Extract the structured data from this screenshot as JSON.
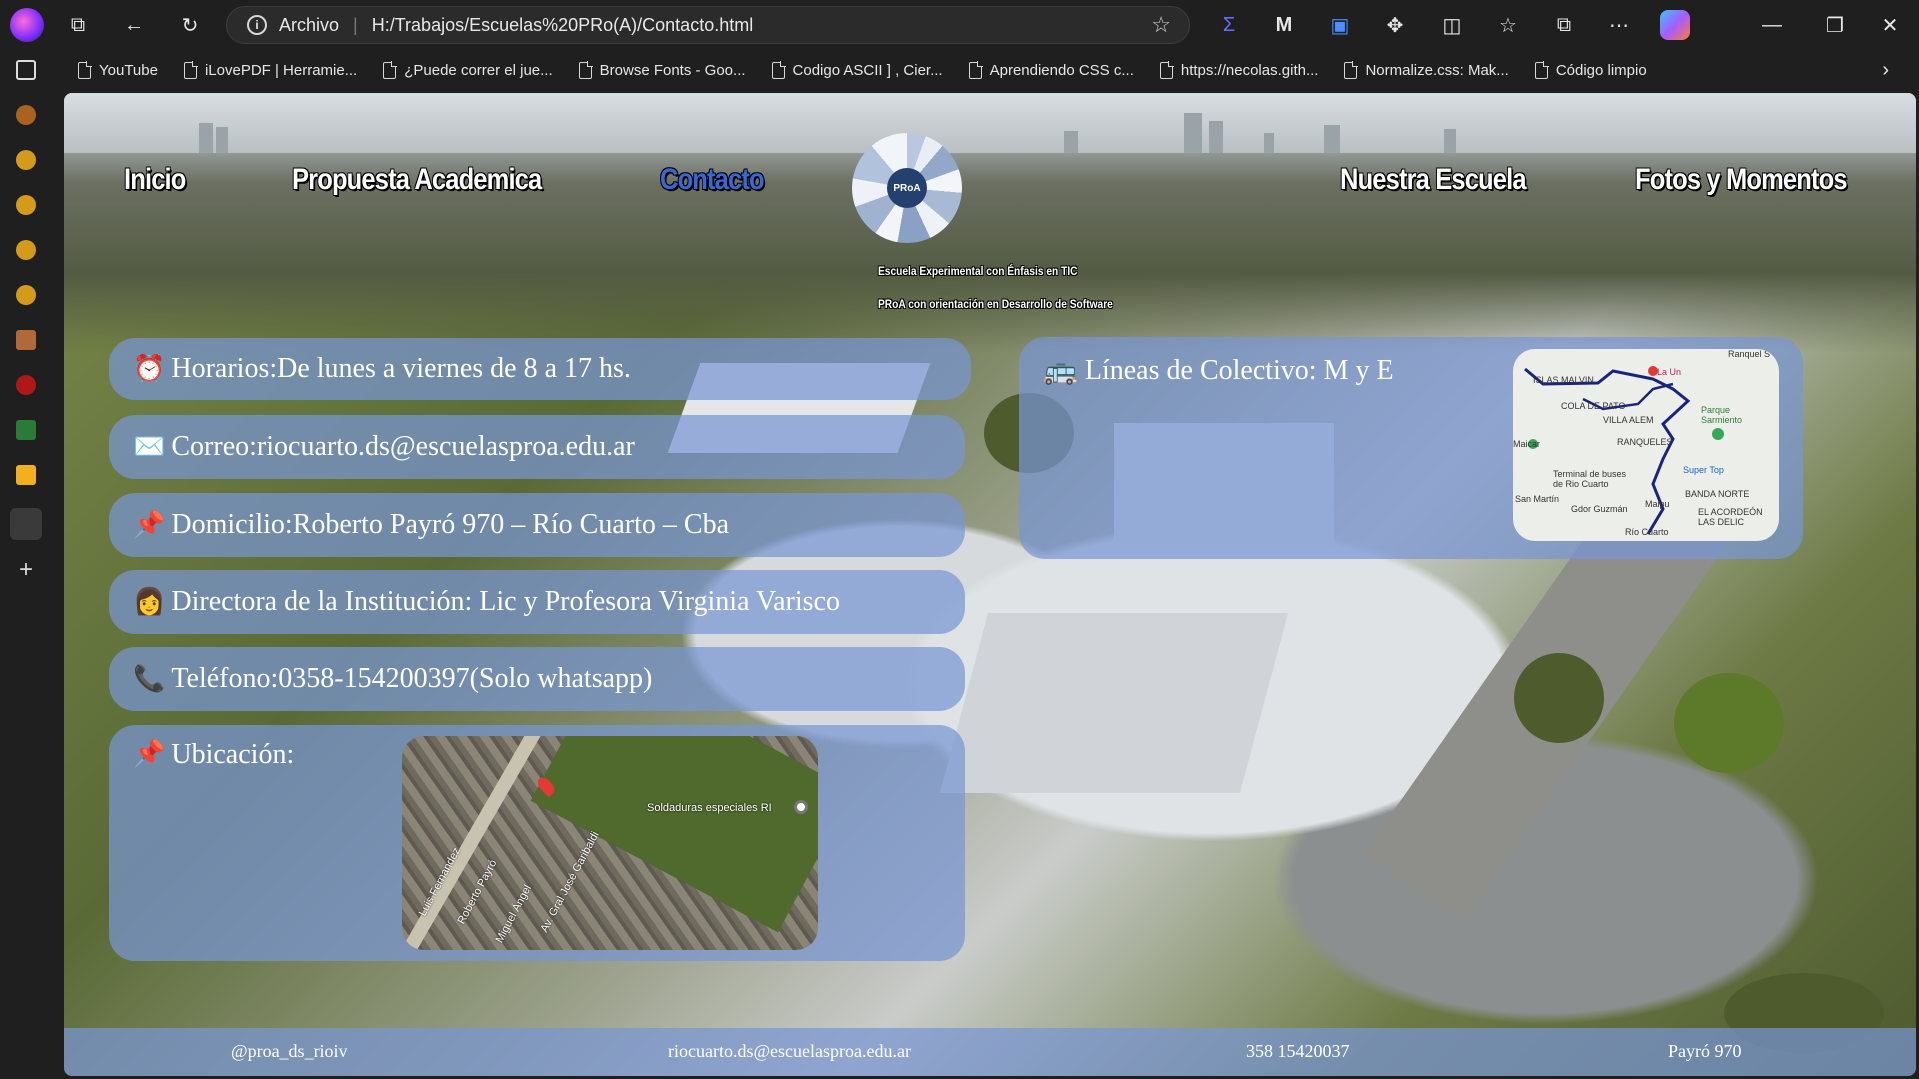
{
  "browser": {
    "address_site": "Archivo",
    "address_url": "H:/Trabajos/Escuelas%20PRo(A)/Contacto.html",
    "bookmarks": [
      "YouTube",
      "iLovePDF | Herramie...",
      "¿Puede correr el jue...",
      "Browse Fonts - Goo...",
      "Codigo ASCII ] , Cier...",
      "Aprendiendo CSS c...",
      "https://necolas.gith...",
      "Normalize.css: Mak...",
      "Código limpio"
    ]
  },
  "nav": {
    "inicio": "Inicio",
    "propuesta": "Propuesta Academica",
    "contacto": "Contacto",
    "nuestra": "Nuestra Escuela",
    "fotos": "Fotos y Momentos"
  },
  "logo": {
    "text": "PRoA",
    "line1": "Escuela Experimental con Énfasis en TIC",
    "line2": "PRoA con orientación en Desarrollo de Software"
  },
  "contact": {
    "horarios": {
      "icon": "⏰",
      "text": "Horarios:De lunes a viernes de 8 a 17 hs."
    },
    "correo": {
      "icon": "✉️",
      "text": "Correo:riocuarto.ds@escuelasproa.edu.ar"
    },
    "domicilio": {
      "icon": "📌",
      "text": "Domicilio:Roberto Payró 970 – Río Cuarto – Cba"
    },
    "directora": {
      "icon": "👩",
      "text": "Directora de la Institución: Lic y Profesora Virginia Varisco"
    },
    "telefono": {
      "icon": "📞",
      "text": "Teléfono:0358-154200397(Solo whatsapp)"
    },
    "ubicacion": {
      "icon": "📌",
      "text": "Ubicación:"
    }
  },
  "bus": {
    "icon": "🚌",
    "text": "Líneas de Colectivo: M y E"
  },
  "route_map_labels": [
    "Ranquel S",
    "ISLAS MALVIN",
    "La Un",
    "COLA DE PATO",
    "VILLA ALEM",
    "Parque Sarmiento",
    "RANQUELES",
    "Terminal de buses de Rio Cuarto",
    "Super Top",
    "BANDA NORTE",
    "EL ACORDEÓN LAS DELIC",
    "Río Cuarto",
    "San Martín",
    "Gdor Guzmán",
    "Maipu",
    "Maicar"
  ],
  "sat_map_labels": [
    "Soldaduras especiales RI",
    "Roberto Payró",
    "Luis Fernandez",
    "Miguel Ángel",
    "Av. Gral José Garibaldi"
  ],
  "footer": {
    "instagram": "@proa_ds_rioiv",
    "email": "riocuarto.ds@escuelasproa.edu.ar",
    "phone": "358 15420037",
    "address": "Payró 970"
  }
}
